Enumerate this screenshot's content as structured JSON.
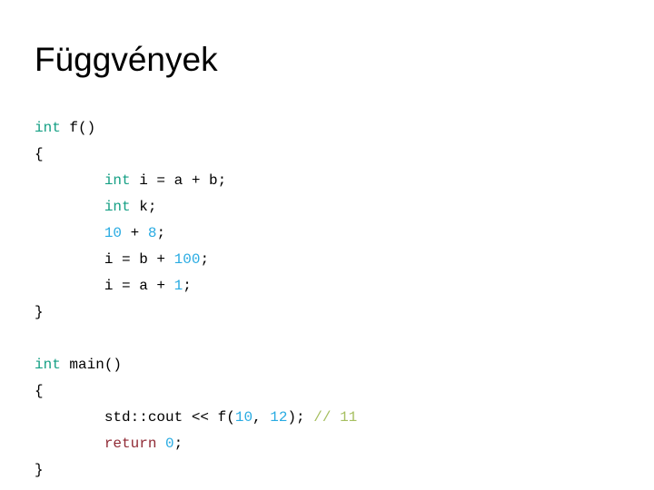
{
  "slide": {
    "title": "Függvények",
    "background_color": "#FFFFFF"
  },
  "colors": {
    "keyword": "#16A085",
    "number": "#29ABE2",
    "comment": "#A6BF60",
    "return_keyword": "#902A35",
    "plain_text": "#000000",
    "title_text": "#000000"
  },
  "code": {
    "language": "cpp",
    "indent": "        ",
    "lines": [
      {
        "index": 0,
        "text": "int f()",
        "tokens": [
          {
            "t": "int",
            "c": "keyword"
          },
          {
            "t": " f()",
            "c": "plain"
          }
        ]
      },
      {
        "index": 1,
        "text": "{",
        "tokens": [
          {
            "t": "{",
            "c": "plain"
          }
        ]
      },
      {
        "index": 2,
        "text": "        int i = a + b;",
        "tokens": [
          {
            "t": "        ",
            "c": "plain"
          },
          {
            "t": "int",
            "c": "keyword"
          },
          {
            "t": " i = a + b;",
            "c": "plain"
          }
        ]
      },
      {
        "index": 3,
        "text": "        int k;",
        "tokens": [
          {
            "t": "        ",
            "c": "plain"
          },
          {
            "t": "int",
            "c": "keyword"
          },
          {
            "t": " k;",
            "c": "plain"
          }
        ]
      },
      {
        "index": 4,
        "text": "        10 + 8;",
        "tokens": [
          {
            "t": "        ",
            "c": "plain"
          },
          {
            "t": "10",
            "c": "number"
          },
          {
            "t": " + ",
            "c": "plain"
          },
          {
            "t": "8",
            "c": "number"
          },
          {
            "t": ";",
            "c": "plain"
          }
        ]
      },
      {
        "index": 5,
        "text": "        i = b + 100;",
        "tokens": [
          {
            "t": "        i = b + ",
            "c": "plain"
          },
          {
            "t": "100",
            "c": "number"
          },
          {
            "t": ";",
            "c": "plain"
          }
        ]
      },
      {
        "index": 6,
        "text": "        i = a + 1;",
        "tokens": [
          {
            "t": "        i = a + ",
            "c": "plain"
          },
          {
            "t": "1",
            "c": "number"
          },
          {
            "t": ";",
            "c": "plain"
          }
        ]
      },
      {
        "index": 7,
        "text": "}",
        "tokens": [
          {
            "t": "}",
            "c": "plain"
          }
        ]
      },
      {
        "index": 8,
        "text": "",
        "tokens": []
      },
      {
        "index": 9,
        "text": "int main()",
        "tokens": [
          {
            "t": "int",
            "c": "keyword"
          },
          {
            "t": " main()",
            "c": "plain"
          }
        ]
      },
      {
        "index": 10,
        "text": "{",
        "tokens": [
          {
            "t": "{",
            "c": "plain"
          }
        ]
      },
      {
        "index": 11,
        "text": "        std::cout << f(10, 12); // 11",
        "tokens": [
          {
            "t": "        std::cout << f(",
            "c": "plain"
          },
          {
            "t": "10",
            "c": "number"
          },
          {
            "t": ", ",
            "c": "plain"
          },
          {
            "t": "12",
            "c": "number"
          },
          {
            "t": "); ",
            "c": "plain"
          },
          {
            "t": "// 11",
            "c": "comment"
          }
        ]
      },
      {
        "index": 12,
        "text": "        return 0;",
        "tokens": [
          {
            "t": "        ",
            "c": "plain"
          },
          {
            "t": "return",
            "c": "return_kw"
          },
          {
            "t": " ",
            "c": "plain"
          },
          {
            "t": "0",
            "c": "number"
          },
          {
            "t": ";",
            "c": "plain"
          }
        ]
      },
      {
        "index": 13,
        "text": "}",
        "tokens": [
          {
            "t": "}",
            "c": "plain"
          }
        ]
      }
    ]
  }
}
